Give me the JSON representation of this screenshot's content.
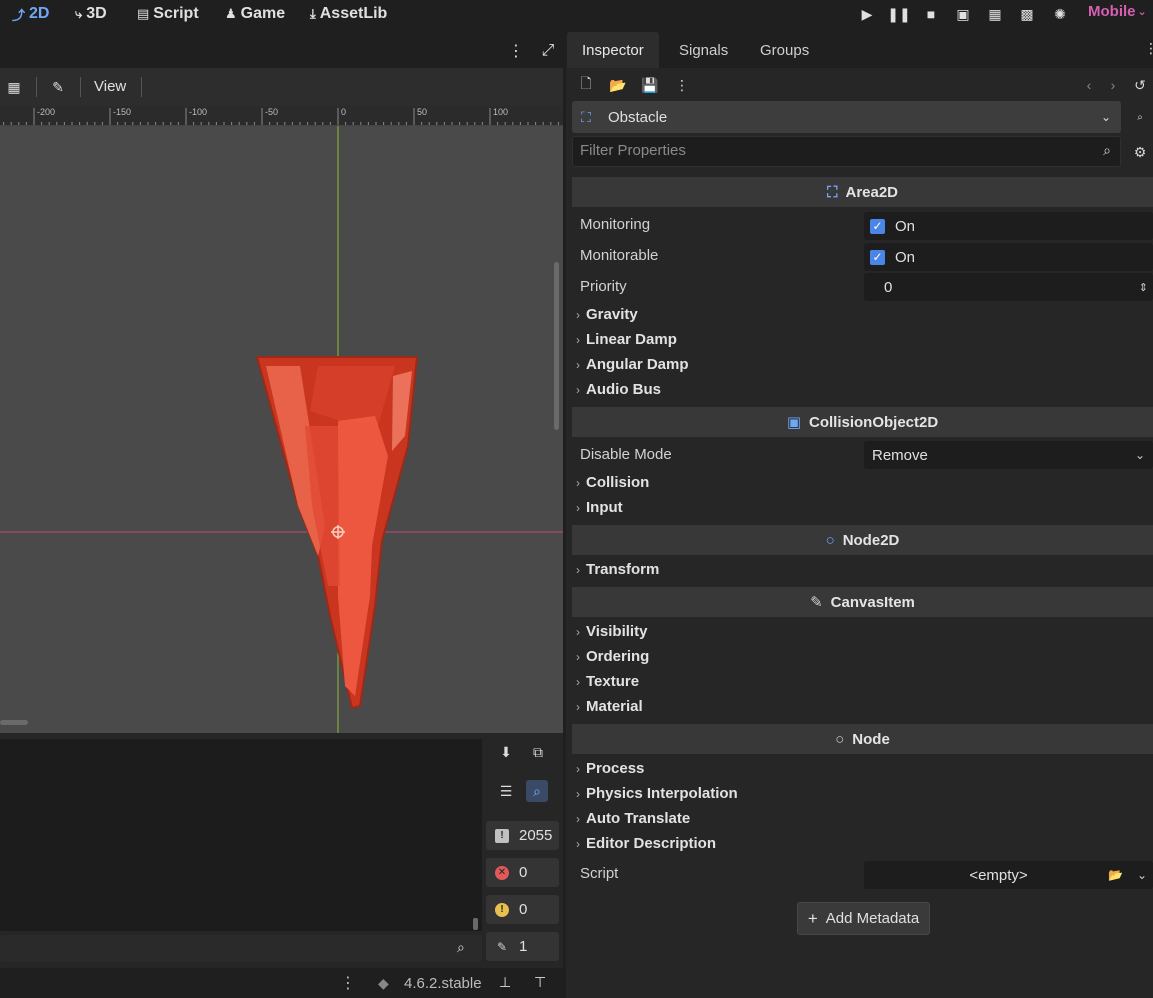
{
  "workspaces": [
    {
      "label": "2D",
      "icon": "2d-icon",
      "active": true
    },
    {
      "label": "3D",
      "icon": "3d-icon",
      "active": false
    },
    {
      "label": "Script",
      "icon": "script-icon",
      "active": false
    },
    {
      "label": "Game",
      "icon": "game-icon",
      "active": false
    },
    {
      "label": "AssetLib",
      "icon": "assetlib-icon",
      "active": false
    }
  ],
  "renderer": "Mobile",
  "editor": {
    "view_menu": "View",
    "ruler_ticks": [
      "-200",
      "-150",
      "-100",
      "-50",
      "0",
      "50",
      "100"
    ]
  },
  "output": {
    "counts": [
      {
        "name": "messages",
        "value": "2055",
        "color": "#c0c0c0"
      },
      {
        "name": "errors",
        "value": "0",
        "color": "#e05a5a"
      },
      {
        "name": "warnings",
        "value": "0",
        "color": "#e8c04c"
      },
      {
        "name": "editor-messages",
        "value": "1",
        "color": "#a0a0a0"
      }
    ]
  },
  "status": {
    "version": "4.6.2.stable"
  },
  "inspector": {
    "tabs": [
      "Inspector",
      "Signals",
      "Groups"
    ],
    "object_name": "Obstacle",
    "filter_placeholder": "Filter Properties",
    "sections": {
      "area2d": "Area2D",
      "collision_object": "CollisionObject2D",
      "node2d": "Node2D",
      "canvas_item": "CanvasItem",
      "node": "Node"
    },
    "props": {
      "monitoring_label": "Monitoring",
      "monitoring_value": "On",
      "monitorable_label": "Monitorable",
      "monitorable_value": "On",
      "priority_label": "Priority",
      "priority_value": "0",
      "disable_mode_label": "Disable Mode",
      "disable_mode_value": "Remove",
      "script_label": "Script",
      "script_value": "<empty>"
    },
    "groups": {
      "gravity": "Gravity",
      "linear_damp": "Linear Damp",
      "angular_damp": "Angular Damp",
      "audio_bus": "Audio Bus",
      "collision": "Collision",
      "input": "Input",
      "transform": "Transform",
      "visibility": "Visibility",
      "ordering": "Ordering",
      "texture": "Texture",
      "material": "Material",
      "process": "Process",
      "physics_interpolation": "Physics Interpolation",
      "auto_translate": "Auto Translate",
      "editor_description": "Editor Description"
    },
    "add_metadata": "Add Metadata"
  },
  "colors": {
    "accent": "#6ea8f7",
    "renderer": "#d65fb3",
    "obstacle_fill": "#e0432f",
    "x_axis": "#c04a7a",
    "y_axis": "#8fb83a"
  }
}
